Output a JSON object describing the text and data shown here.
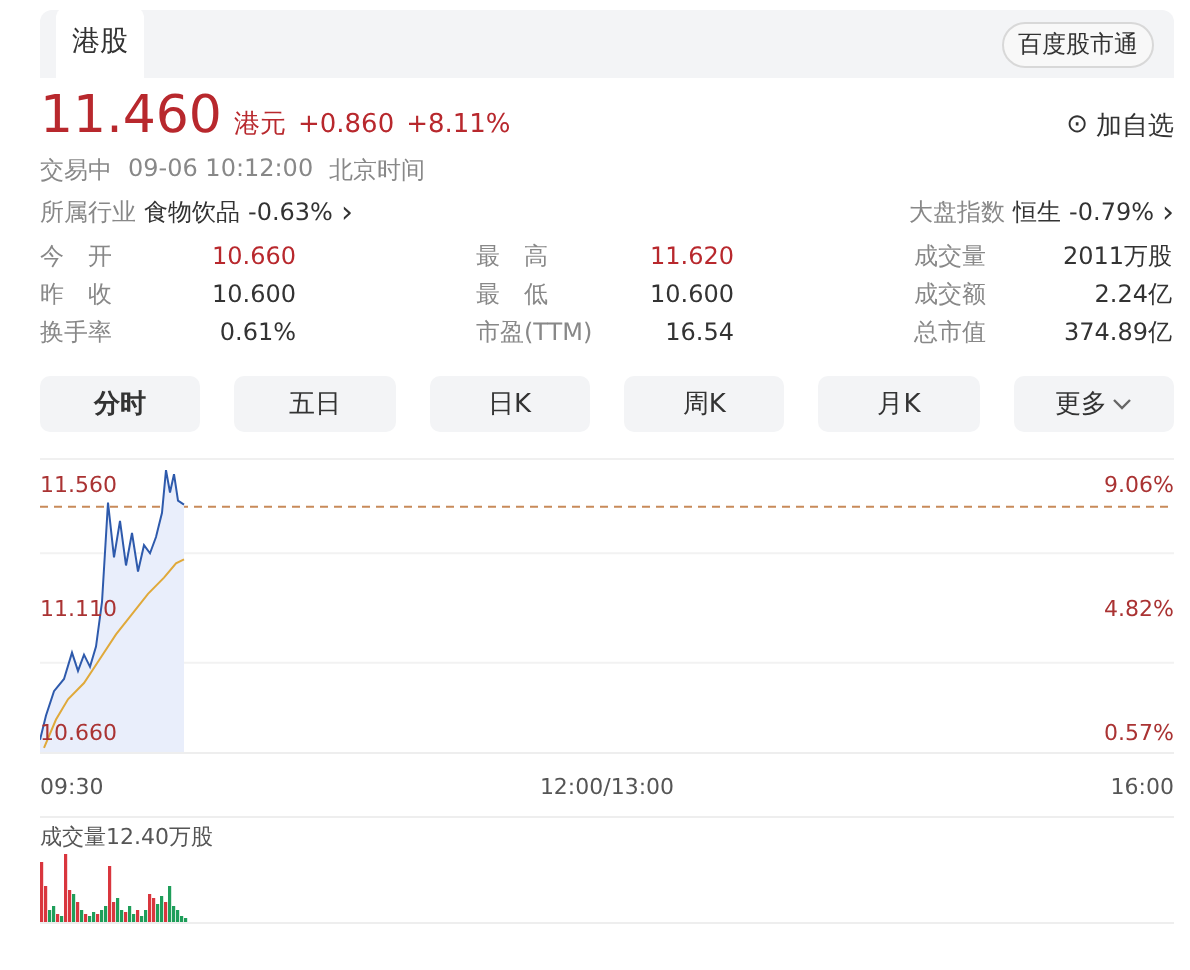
{
  "header": {
    "tab": {
      "label": "港股",
      "selected": true
    },
    "service_button": "百度股市通"
  },
  "quote": {
    "price": "11.460",
    "currency": "港元",
    "change": "+0.860",
    "change_percent": "+8.11%",
    "watch_button": "加自选",
    "watch_icon": "⊙"
  },
  "status": {
    "state": "交易中",
    "time": "09-06 10:12:00",
    "timezone": "北京时间"
  },
  "industry": {
    "label": "所属行业",
    "name": "食物饮品",
    "change": "-0.63%",
    "arrow": "›"
  },
  "index": {
    "label": "大盘指数",
    "name": "恒生",
    "change": "-0.79%",
    "arrow": "›"
  },
  "stats": [
    {
      "label": "今　开",
      "value": "10.660",
      "color": "#b8282d"
    },
    {
      "label": "最　高",
      "value": "11.620",
      "color": "#b8282d"
    },
    {
      "label": "成交量",
      "value": "2011万股",
      "color": "#333333"
    },
    {
      "label": "昨　收",
      "value": "10.600",
      "color": "#333333"
    },
    {
      "label": "最　低",
      "value": "10.600",
      "color": "#333333"
    },
    {
      "label": "成交额",
      "value": "2.24亿",
      "color": "#333333"
    },
    {
      "label": "换手率",
      "value": "0.61%",
      "color": "#333333"
    },
    {
      "label": "市盈(TTM)",
      "value": "16.54",
      "color": "#333333"
    },
    {
      "label": "总市值",
      "value": "374.89亿",
      "color": "#333333"
    }
  ],
  "periods": [
    {
      "label": "分时",
      "selected": true
    },
    {
      "label": "五日",
      "selected": false
    },
    {
      "label": "日K",
      "selected": false
    },
    {
      "label": "周K",
      "selected": false
    },
    {
      "label": "月K",
      "selected": false
    },
    {
      "label": "更多",
      "selected": false,
      "dropdown": true
    }
  ],
  "chart": {
    "price_labels": [
      "11.560",
      "11.110",
      "10.660"
    ],
    "percent_labels": [
      "9.06%",
      "4.82%",
      "0.57%"
    ],
    "time_labels": [
      "09:30",
      "12:00/13:00",
      "16:00"
    ],
    "volume_label": "成交量12.40万股"
  }
}
